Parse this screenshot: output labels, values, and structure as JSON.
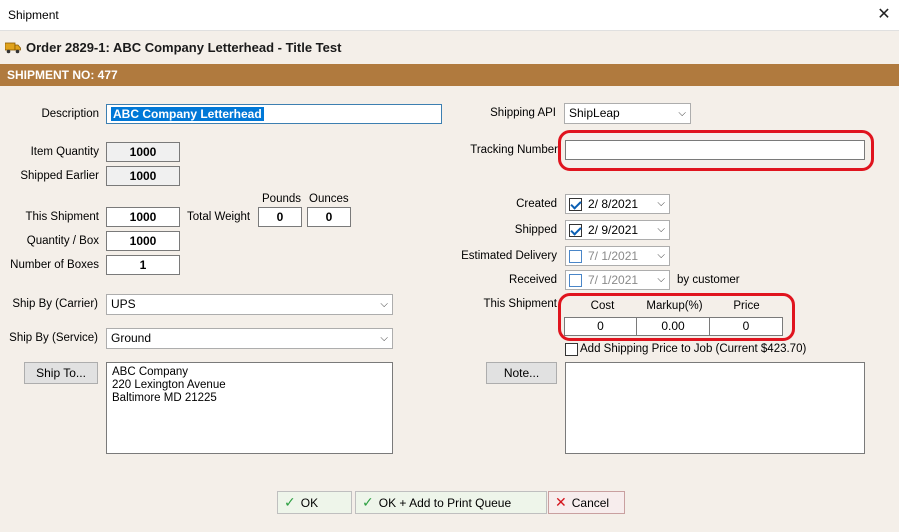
{
  "window": {
    "title": "Shipment",
    "close_glyph": "✕"
  },
  "header": {
    "order_title": "Order 2829-1: ABC Company Letterhead - Title Test",
    "section_label": "SHIPMENT NO: 477"
  },
  "left": {
    "description_label": "Description",
    "description_value": "ABC Company Letterhead",
    "item_quantity_label": "Item Quantity",
    "item_quantity": "1000",
    "shipped_earlier_label": "Shipped Earlier",
    "shipped_earlier": "1000",
    "this_shipment_label": "This Shipment",
    "this_shipment": "1000",
    "total_weight_label": "Total Weight",
    "pounds_label": "Pounds",
    "pounds": "0",
    "ounces_label": "Ounces",
    "ounces": "0",
    "quantity_box_label": "Quantity / Box",
    "quantity_box": "1000",
    "number_boxes_label": "Number of Boxes",
    "number_boxes": "1",
    "ship_by_carrier_label": "Ship By (Carrier)",
    "ship_by_carrier": "UPS",
    "ship_by_service_label": "Ship By (Service)",
    "ship_by_service": "Ground",
    "ship_to_button": "Ship To...",
    "ship_to_address": "ABC Company\n220 Lexington Avenue\nBaltimore MD 21225"
  },
  "right": {
    "shipping_api_label": "Shipping API",
    "shipping_api": "ShipLeap",
    "tracking_label": "Tracking Number",
    "tracking_value": "",
    "created_label": "Created",
    "created_date": "2/ 8/2021",
    "shipped_label": "Shipped",
    "shipped_date": "2/ 9/2021",
    "est_delivery_label": "Estimated Delivery",
    "est_delivery_date": "7/ 1/2021",
    "received_label": "Received",
    "received_date": "7/ 1/2021",
    "by_customer": "by customer",
    "this_shipment_label": "This Shipment",
    "cost_header": "Cost",
    "markup_header": "Markup(%)",
    "price_header": "Price",
    "cost": "0",
    "markup": "0.00",
    "price": "0",
    "add_shipping_label": "Add Shipping Price to Job (Current $423.70)",
    "note_button": "Note..."
  },
  "footer": {
    "ok": "OK",
    "ok_print": "OK + Add to Print Queue",
    "cancel": "Cancel"
  },
  "icons": {
    "check": "✓",
    "cancel": "✕",
    "chevron": "⌵"
  },
  "colors": {
    "section_bar": "#b07a3e",
    "highlight_ring": "#e0141e",
    "selection": "#0078d7"
  }
}
